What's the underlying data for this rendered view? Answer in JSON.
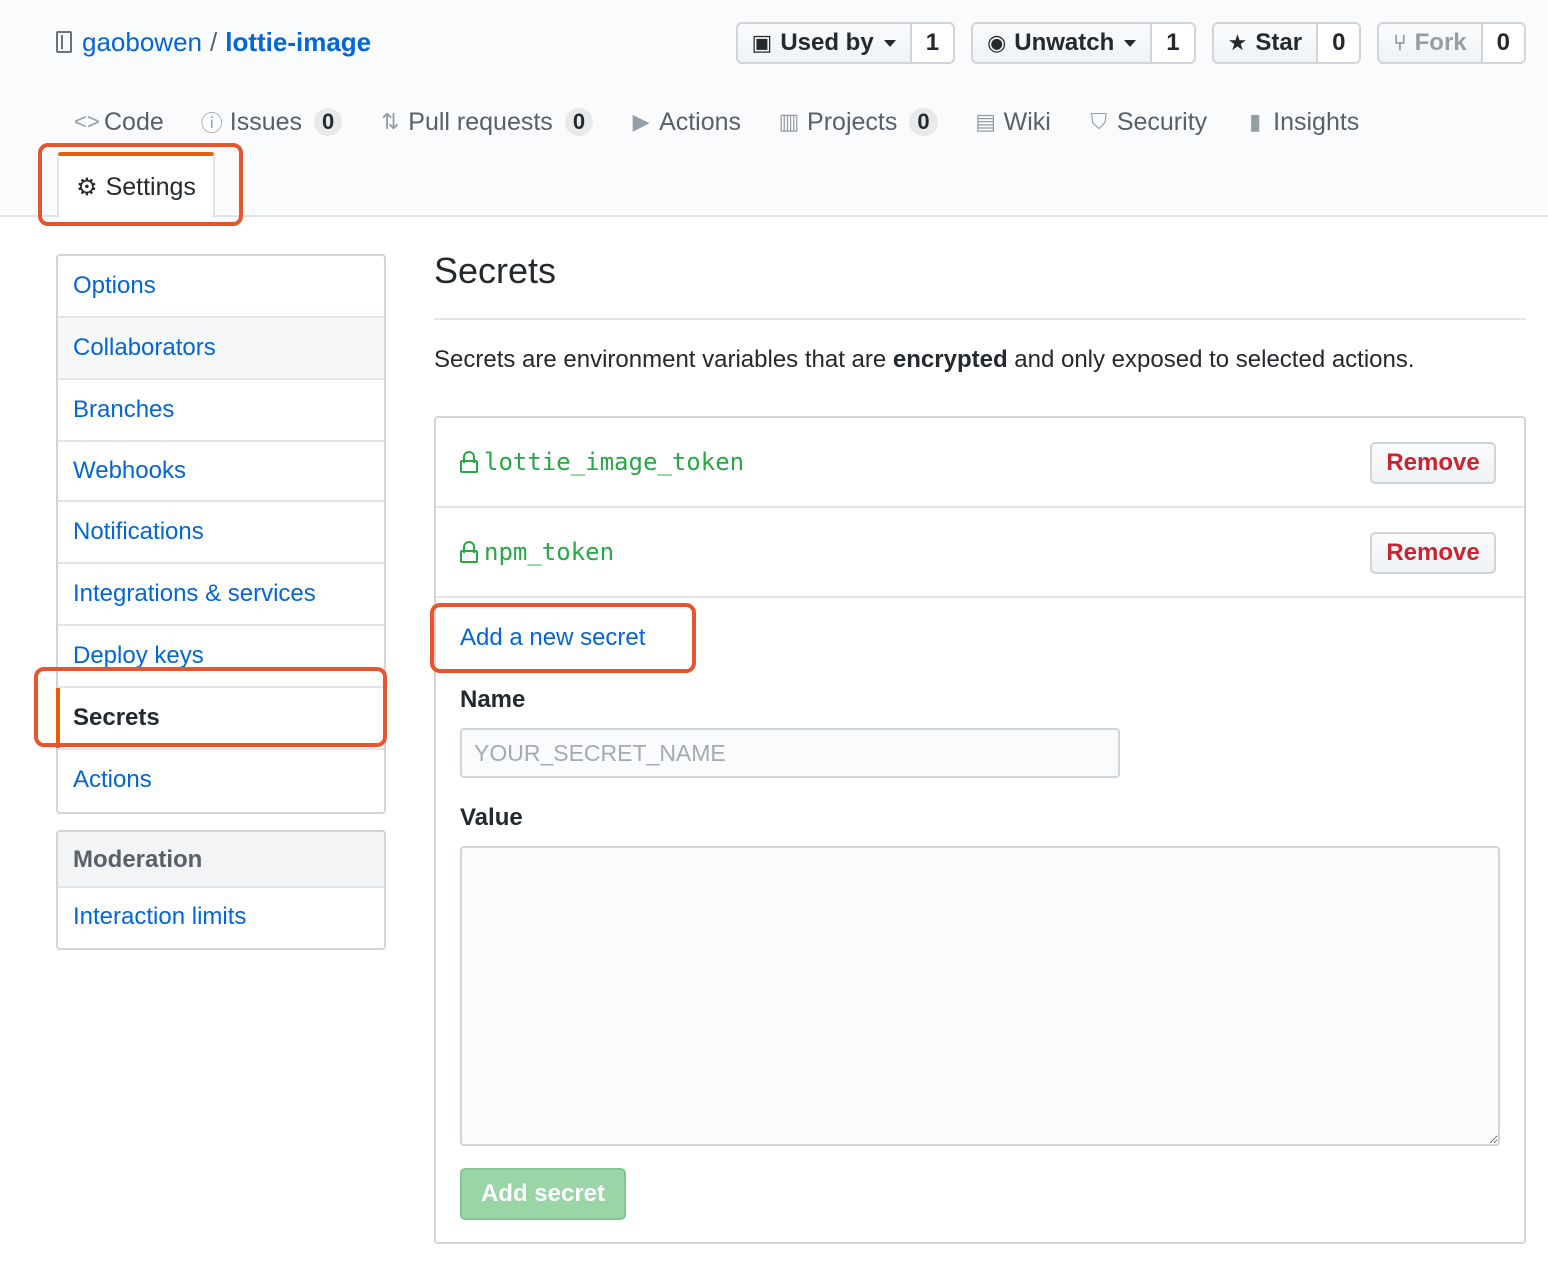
{
  "repo": {
    "owner": "gaobowen",
    "separator": "/",
    "name": "lottie-image"
  },
  "actions": {
    "used_by": {
      "label": "Used by",
      "count": "1"
    },
    "unwatch": {
      "label": "Unwatch",
      "count": "1"
    },
    "star": {
      "label": "Star",
      "count": "0"
    },
    "fork": {
      "label": "Fork",
      "count": "0"
    }
  },
  "nav": {
    "code": "Code",
    "issues": {
      "label": "Issues",
      "count": "0"
    },
    "pulls": {
      "label": "Pull requests",
      "count": "0"
    },
    "actions": "Actions",
    "projects": {
      "label": "Projects",
      "count": "0"
    },
    "wiki": "Wiki",
    "security": "Security",
    "insights": "Insights",
    "settings": "Settings"
  },
  "sidebar": {
    "items": [
      "Options",
      "Collaborators",
      "Branches",
      "Webhooks",
      "Notifications",
      "Integrations & services",
      "Deploy keys",
      "Secrets",
      "Actions"
    ],
    "selected": "Secrets",
    "moderation_heading": "Moderation",
    "moderation_items": [
      "Interaction limits"
    ]
  },
  "main": {
    "title": "Secrets",
    "desc_before": "Secrets are environment variables that are ",
    "desc_bold": "encrypted",
    "desc_after": " and only exposed to selected actions.",
    "secrets": [
      {
        "name": "lottie_image_token",
        "remove_label": "Remove"
      },
      {
        "name": "npm_token",
        "remove_label": "Remove"
      }
    ],
    "add_link": "Add a new secret",
    "name_label": "Name",
    "name_placeholder": "YOUR_SECRET_NAME",
    "value_label": "Value",
    "add_button": "Add secret"
  },
  "colors": {
    "link": "#0366d6",
    "secret_name": "#28a745",
    "remove": "#cb2431",
    "highlight": "#e8552c",
    "selected_bar": "#e36209",
    "add_button": "#94d3a2"
  }
}
